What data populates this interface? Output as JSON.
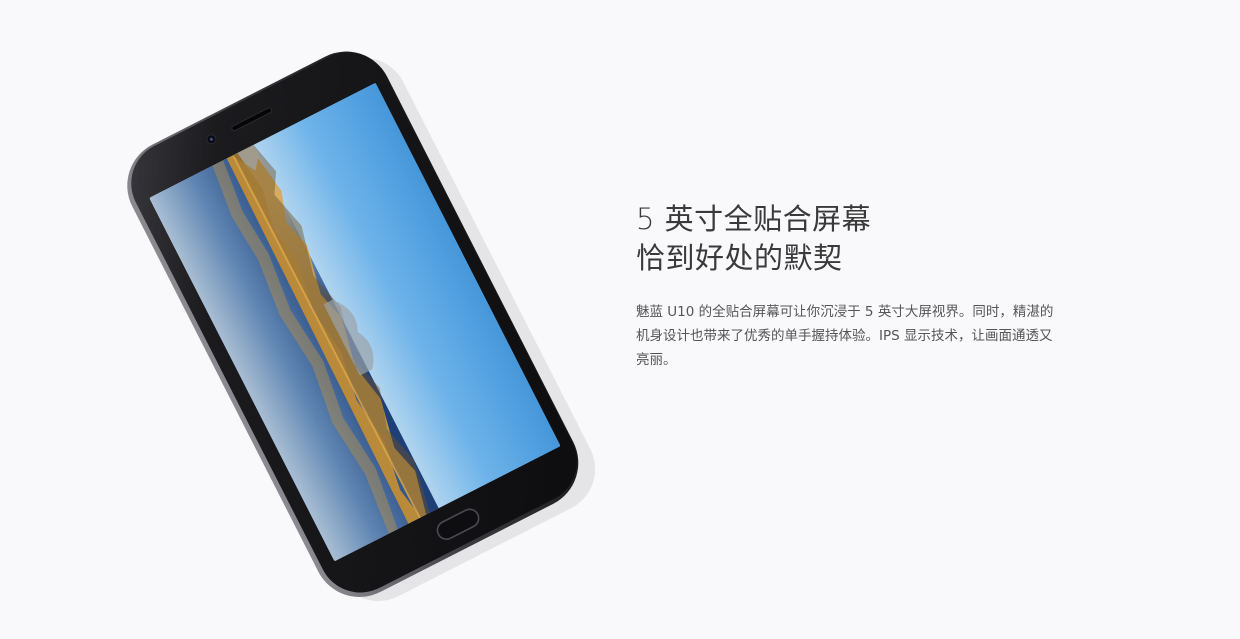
{
  "hero": {
    "headline_line1": "5 英寸全贴合屏幕",
    "headline_line2": "恰到好处的默契",
    "description": "魅蓝 U10 的全贴合屏幕可让你沉浸于 5 英寸大屏视界。同时，精湛的机身设计也带来了优秀的单手握持体验。IPS 显示技术，让画面通透又亮丽。"
  },
  "colors": {
    "background": "#f9f8fb",
    "phone_body": "#151517",
    "headline": "#3a3a3a",
    "body_text": "#555555"
  },
  "product_image": {
    "subject": "phone-front-angled",
    "screen_wallpaper": "lake-landscape-reflection"
  }
}
